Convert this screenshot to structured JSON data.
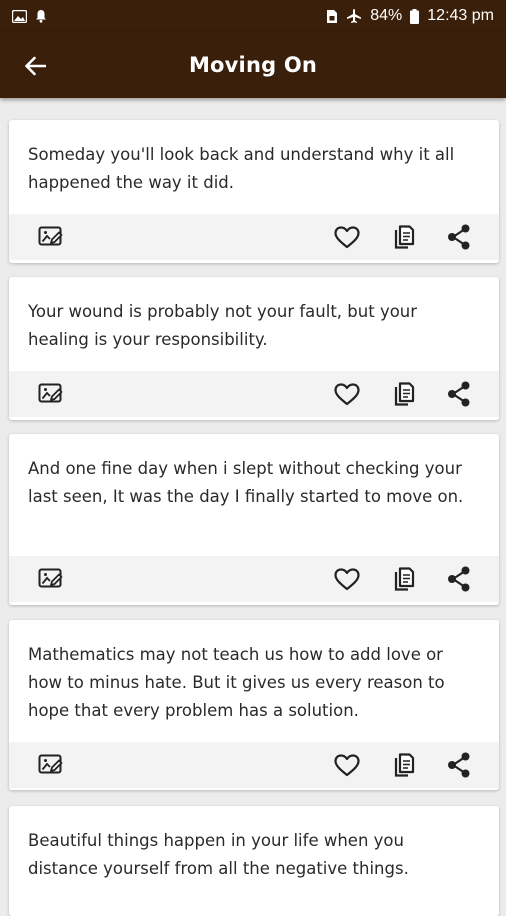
{
  "status_bar": {
    "battery": "84%",
    "time": "12:43 pm"
  },
  "app_bar": {
    "title": "Moving On"
  },
  "colors": {
    "app_bar": "#3a1f0a",
    "background": "#ececec",
    "card": "#ffffff",
    "action_bar": "#f3f3f3",
    "icon": "#222222"
  },
  "quotes": [
    {
      "text": "Someday you'll look back and understand why it all happened the way it did."
    },
    {
      "text": "Your wound is probably not your fault, but your healing is your responsibility."
    },
    {
      "text": "And one fine day when i slept without checking your last seen, It was the day I finally started to move on."
    },
    {
      "text": "Mathematics may not teach us how to add love or how to minus hate. But it gives us every reason to hope that every problem has a solution."
    },
    {
      "text": "Beautiful things happen in your life when you distance yourself from all the negative things."
    }
  ],
  "card_actions": [
    "edit-image-icon",
    "heart-icon",
    "copy-icon",
    "share-icon"
  ]
}
